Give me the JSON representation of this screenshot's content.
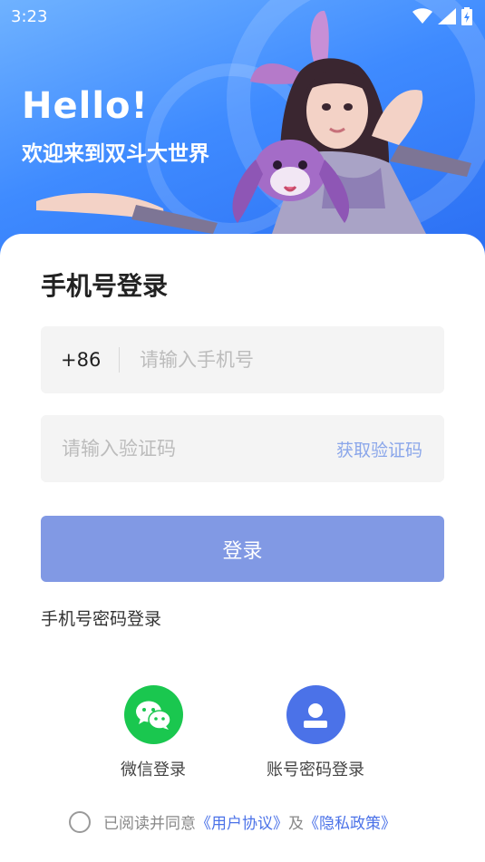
{
  "status_bar": {
    "time": "3:23"
  },
  "hero": {
    "greeting": "Hello!",
    "welcome": "欢迎来到双斗大世界"
  },
  "login": {
    "title": "手机号登录",
    "country_code": "+86",
    "phone_placeholder": "请输入手机号",
    "code_placeholder": "请输入验证码",
    "get_code_label": "获取验证码",
    "login_button_label": "登录",
    "password_login_link": "手机号密码登录"
  },
  "social_login": [
    {
      "label": "微信登录",
      "icon": "wechat-icon"
    },
    {
      "label": "账号密码登录",
      "icon": "user-icon"
    }
  ],
  "agreement": {
    "prefix": "已阅读并同意",
    "user_agreement": "《用户协议》",
    "conjunction": "及",
    "privacy_policy": "《隐私政策》",
    "checked": false
  },
  "colors": {
    "hero_gradient_start": "#6fb2ff",
    "hero_gradient_end": "#2a6df2",
    "login_button": "#8199e4",
    "link_blue": "#4b72e8",
    "wechat_green": "#1ac74f"
  }
}
